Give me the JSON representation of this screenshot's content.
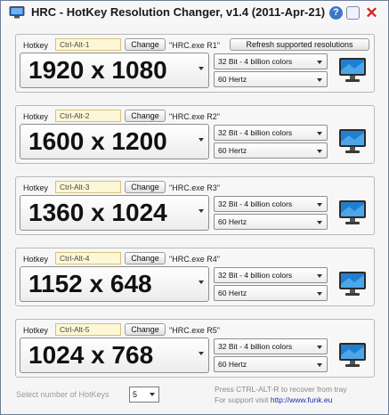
{
  "window": {
    "title": "HRC - HotKey Resolution Changer, v1.4 (2011-Apr-21)",
    "help_symbol": "?",
    "close_symbol": "✕"
  },
  "labels": {
    "hotkey": "Hotkey",
    "change": "Change",
    "refresh": "Refresh supported resolutions"
  },
  "profiles": [
    {
      "hotkey": "Ctrl-Alt-1",
      "exe": "\"HRC.exe R1\"",
      "resolution": "1920 x 1080",
      "colors": "32 Bit - 4 billion colors",
      "frequency": "60 Hertz"
    },
    {
      "hotkey": "Ctrl-Alt-2",
      "exe": "\"HRC.exe R2\"",
      "resolution": "1600 x 1200",
      "colors": "32 Bit - 4 billion colors",
      "frequency": "60 Hertz"
    },
    {
      "hotkey": "Ctrl-Alt-3",
      "exe": "\"HRC.exe R3\"",
      "resolution": "1360 x 1024",
      "colors": "32 Bit - 4 billion colors",
      "frequency": "60 Hertz"
    },
    {
      "hotkey": "Ctrl-Alt-4",
      "exe": "\"HRC.exe R4\"",
      "resolution": "1152 x 648",
      "colors": "32 Bit - 4 billion colors",
      "frequency": "60 Hertz"
    },
    {
      "hotkey": "Ctrl-Alt-5",
      "exe": "\"HRC.exe R5\"",
      "resolution": "1024 x 768",
      "colors": "32 Bit - 4 billion colors",
      "frequency": "60 Hertz"
    }
  ],
  "footer": {
    "select_label": "Select number of HotKeys",
    "hotkey_count": "5",
    "recover_text": "Press CTRL-ALT-R to recover from tray",
    "support_text": "For support visit",
    "support_link": "http://www.funk.eu"
  }
}
